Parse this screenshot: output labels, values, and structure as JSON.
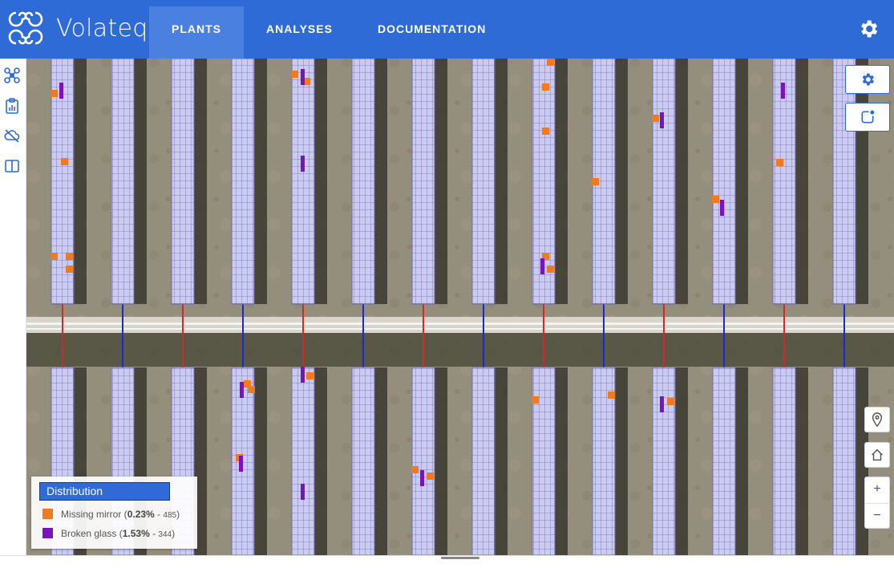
{
  "app": {
    "brand": "Volateq"
  },
  "nav": {
    "tabs": [
      {
        "label": "PLANTS",
        "active": true
      },
      {
        "label": "ANALYSES",
        "active": false
      },
      {
        "label": "DOCUMENTATION",
        "active": false
      }
    ]
  },
  "header": {
    "settings_icon": "gear-icon"
  },
  "sidebar": {
    "icons": [
      "drone-icon",
      "clipboard-chart-icon",
      "cloud-off-icon",
      "split-view-icon"
    ]
  },
  "map_controls": {
    "icons": [
      "gear-icon",
      "notification-icon",
      "location-pin-icon",
      "home-icon"
    ],
    "zoom_in": "+",
    "zoom_out": "−"
  },
  "legend": {
    "title": "Distribution",
    "items": [
      {
        "label": "Missing mirror",
        "percent": "0.23%",
        "count": "485",
        "color": "#f07a1f"
      },
      {
        "label": "Broken glass",
        "percent": "1.53%",
        "count": "344",
        "color": "#7d12b8"
      }
    ]
  },
  "colors": {
    "brand": "#2f6bd6",
    "panel": "#c9c9f2",
    "missing_mirror": "#f07a1f",
    "broken_glass": "#7d12b8"
  }
}
